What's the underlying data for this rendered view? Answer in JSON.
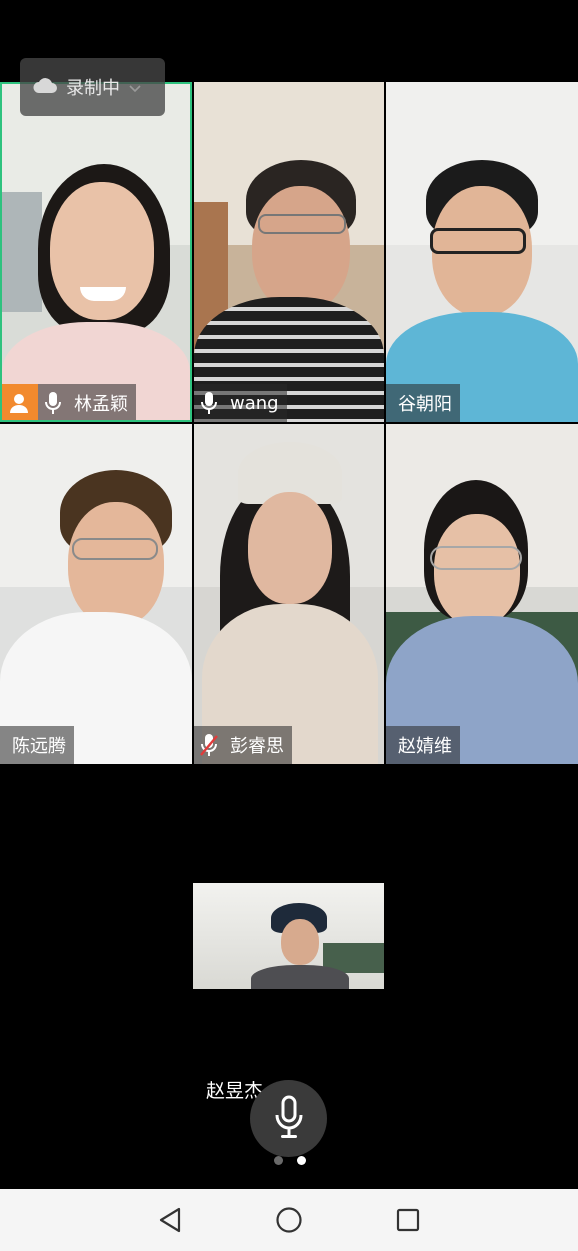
{
  "recording": {
    "label": "录制中",
    "icon": "cloud-icon"
  },
  "participants": [
    {
      "name": "林孟颖",
      "mic": "on",
      "host": true,
      "active": true
    },
    {
      "name": "wang",
      "mic": "on"
    },
    {
      "name": "谷朝阳"
    },
    {
      "name": "陈远腾"
    },
    {
      "name": "彭睿思",
      "mic": "muted"
    },
    {
      "name": "赵婧维"
    }
  ],
  "self": {
    "name": "赵昱杰"
  },
  "pager": {
    "pages": 2,
    "current": 2
  },
  "colors": {
    "active_border": "#2ec27e",
    "host_badge": "#f28a2e",
    "muted_slash": "#e23b3b"
  }
}
